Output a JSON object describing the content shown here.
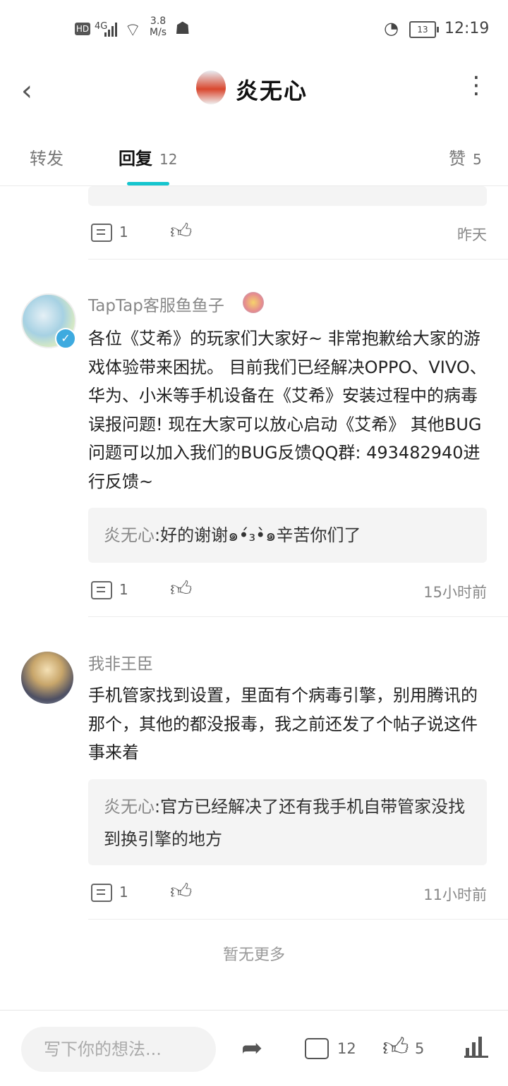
{
  "status_bar": {
    "hd": "HD",
    "net": "4G",
    "speed_value": "3.8",
    "speed_unit": "M/s",
    "battery": "13",
    "time": "12:19"
  },
  "header": {
    "title": "炎无心",
    "back_icon": "chevron-left-icon",
    "more_icon": "more-vertical-icon"
  },
  "tabs": {
    "forward_label": "转发",
    "reply_label": "回复",
    "reply_count": "12",
    "likes_label": "赞",
    "likes_count": "5"
  },
  "first_item": {
    "reply_count": "1",
    "time": "昨天"
  },
  "comments": [
    {
      "author": "TapTap客服鱼鱼子",
      "text": "各位《艾希》的玩家们大家好~ 非常抱歉给大家的游戏体验带来困扰。 目前我们已经解决OPPO、VIVO、华为、小米等手机设备在《艾希》安装过程中的病毒误报问题! 现在大家可以放心启动《艾希》 其他BUG问题可以加入我们的BUG反馈QQ群: 493482940进行反馈~",
      "reply_author": "炎无心",
      "reply_text": ":好的谢谢๑•́₃•̀๑辛苦你们了",
      "reply_count": "1",
      "time": "15小时前"
    },
    {
      "author": "我非王臣",
      "text": "手机管家找到设置，里面有个病毒引擎，别用腾讯的那个，其他的都没报毒，我之前还发了个帖子说这件事来着",
      "reply_author": "炎无心",
      "reply_text": ":官方已经解决了还有我手机自带管家没找到换引擎的地方",
      "reply_count": "1",
      "time": "11小时前"
    }
  ],
  "no_more": "暂无更多",
  "bottom_bar": {
    "placeholder": "写下你的想法...",
    "comment_count": "12",
    "like_count": "5"
  },
  "colors": {
    "accent": "#15c5ce",
    "verify": "#3eaadf"
  }
}
